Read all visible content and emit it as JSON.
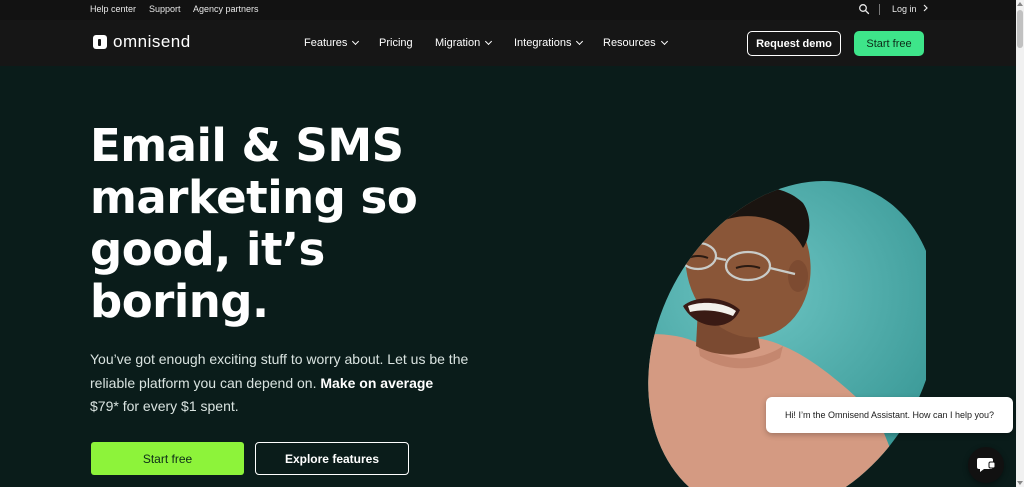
{
  "topbar": {
    "links": [
      "Help center",
      "Support",
      "Agency partners"
    ],
    "login": "Log in"
  },
  "nav": {
    "logo_text": "omnisend",
    "items": [
      {
        "label": "Features",
        "has_dropdown": true
      },
      {
        "label": "Pricing",
        "has_dropdown": false
      },
      {
        "label": "Migration",
        "has_dropdown": true
      },
      {
        "label": "Integrations",
        "has_dropdown": true
      },
      {
        "label": "Resources",
        "has_dropdown": true
      }
    ],
    "request_demo": "Request demo",
    "start_free": "Start free"
  },
  "hero": {
    "title_lines": [
      "Email & SMS",
      "marketing so",
      "good, it’s",
      "boring."
    ],
    "subtitle": "You’ve got enough exciting stuff to worry about. Let us be the reliable platform you can depend on. ",
    "subtitle_bold": "Make on average",
    "subtitle_tail": "$79* for every $1 spent.",
    "primary_cta": "Start free",
    "secondary_cta": "Explore features"
  },
  "chat": {
    "message": "Hi! I’m the Omnisend Assistant. How can I help you?"
  },
  "colors": {
    "nav_bg": "#161616",
    "hero_bg": "#0a1c1a",
    "accent_green": "#3ee58a",
    "cta_lime": "#8df33a",
    "circle_teal": "#4aa8a6"
  },
  "icons": {
    "search": "search-icon",
    "login_chevron": "chevron-right-icon",
    "dropdown": "chevron-down-icon",
    "chat": "chat-icon"
  }
}
